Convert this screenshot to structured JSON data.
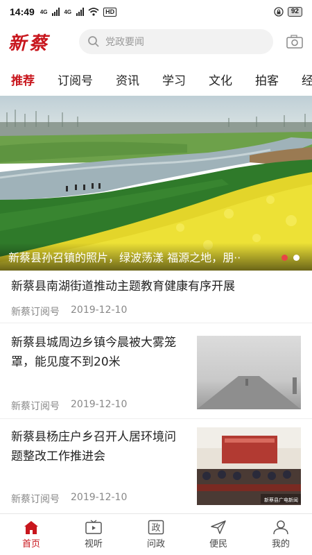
{
  "status_bar": {
    "time": "14:49",
    "signal_label_1": "4G",
    "signal_label_2": "4G",
    "hd_badge": "HD",
    "battery": "92"
  },
  "header": {
    "logo_text": "新蔡",
    "search_placeholder": "党政要闻"
  },
  "tabs": [
    {
      "label": "推荐",
      "active": true
    },
    {
      "label": "订阅号",
      "active": false
    },
    {
      "label": "资讯",
      "active": false
    },
    {
      "label": "学习",
      "active": false
    },
    {
      "label": "文化",
      "active": false
    },
    {
      "label": "拍客",
      "active": false
    },
    {
      "label": "经济",
      "active": false
    }
  ],
  "banner": {
    "caption": "新蔡县孙召镇的照片，绿波荡漾 福源之地，朋··",
    "dot_colors": [
      "#e84545",
      "#ffffff"
    ]
  },
  "news": [
    {
      "title_lines": [
        "新蔡县南湖街道推动主题教育健康有序开展"
      ],
      "source": "新蔡订阅号",
      "date": "2019-12-10"
    },
    {
      "title_lines": [
        "新蔡县城周边乡镇今晨被大雾笼",
        "罩，能见度不到20米"
      ],
      "source": "新蔡订阅号",
      "date": "2019-12-10"
    },
    {
      "title_lines": [
        "新蔡县杨庄户乡召开人居环境问",
        "题整改工作推进会"
      ],
      "source": "新蔡订阅号",
      "date": "2019-12-10",
      "thumb_watermark": "新蔡县广电新闻"
    }
  ],
  "bottom_nav": [
    {
      "label": "首页",
      "icon": "home-icon",
      "active": true
    },
    {
      "label": "视听",
      "icon": "tv-icon",
      "active": false
    },
    {
      "label": "问政",
      "icon": "zheng-icon",
      "active": false,
      "icon_text": "政"
    },
    {
      "label": "便民",
      "icon": "send-icon",
      "active": false
    },
    {
      "label": "我的",
      "icon": "user-icon",
      "active": false
    }
  ],
  "colors": {
    "accent": "#c8161d",
    "inactive": "#444444"
  }
}
